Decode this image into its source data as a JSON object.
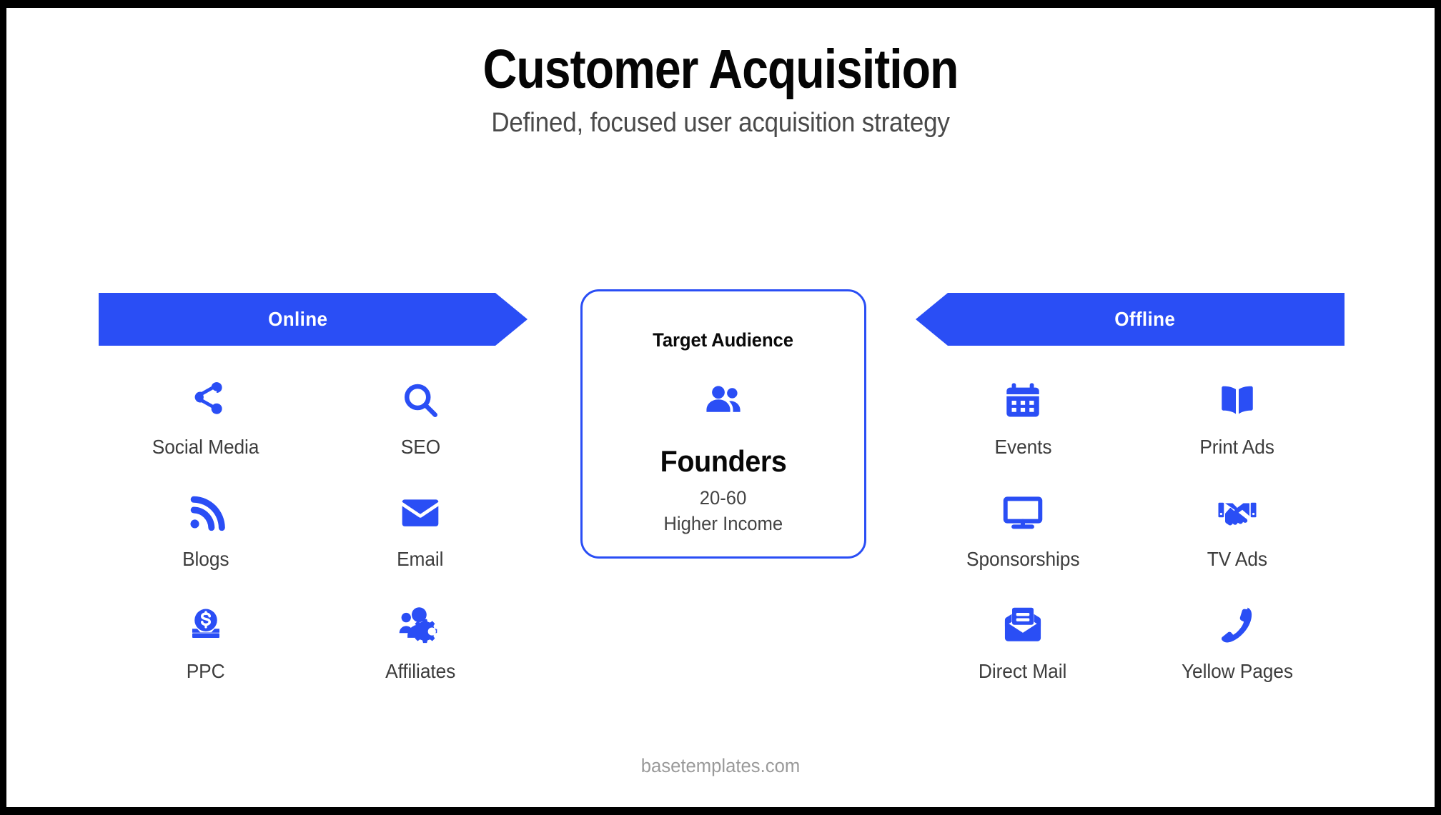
{
  "header": {
    "title": "Customer Acquisition",
    "subtitle": "Defined, focused user acquisition strategy"
  },
  "banners": {
    "online": {
      "label": "Online",
      "direction": "right",
      "color": "#2a4ef5"
    },
    "offline": {
      "label": "Offline",
      "direction": "left",
      "color": "#2a4ef5"
    }
  },
  "online_channels": [
    {
      "label": "Social Media",
      "icon": "share-icon"
    },
    {
      "label": "SEO",
      "icon": "magnifying-glass-icon"
    },
    {
      "label": "Blogs",
      "icon": "rss-feed-icon"
    },
    {
      "label": "Email",
      "icon": "envelope-icon"
    },
    {
      "label": "PPC",
      "icon": "coin-dollar-icon"
    },
    {
      "label": "Affiliates",
      "icon": "people-gear-icon"
    }
  ],
  "offline_channels": [
    {
      "label": "Events",
      "icon": "calendar-icon"
    },
    {
      "label": "Print Ads",
      "icon": "open-book-icon"
    },
    {
      "label": "Sponsorships",
      "icon": "monitor-icon"
    },
    {
      "label": "TV Ads",
      "icon": "handshake-icon"
    },
    {
      "label": "Direct Mail",
      "icon": "open-envelope-letter-icon"
    },
    {
      "label": "Yellow Pages",
      "icon": "phone-handset-icon"
    }
  ],
  "audience_card": {
    "heading": "Target Audience",
    "icon": "users-icon",
    "name": "Founders",
    "detail_1": "20-60",
    "detail_2": "Higher Income",
    "border_color": "#2a4ef5"
  },
  "footer": {
    "text": "basetemplates.com"
  },
  "theme": {
    "accent": "#2a4ef5",
    "title_color": "#050505",
    "body_text_color": "#3d3d3d",
    "footer_color": "#9a9a9a",
    "background": "#ffffff",
    "frame": "#000000"
  }
}
